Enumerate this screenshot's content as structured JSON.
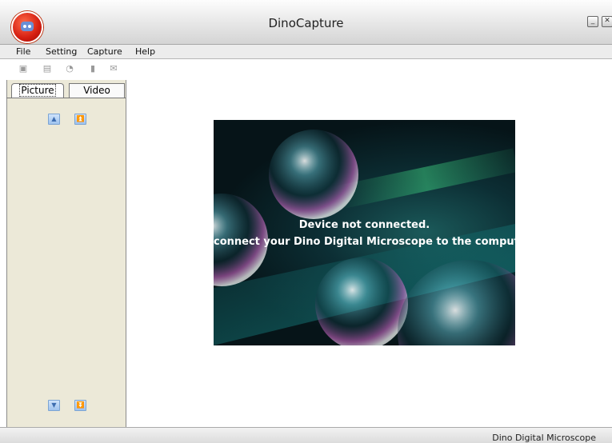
{
  "window": {
    "title": "DinoCapture",
    "minimize_glyph": "_",
    "close_glyph": "✕"
  },
  "menu": {
    "items": [
      {
        "label": "File"
      },
      {
        "label": "Setting"
      },
      {
        "label": "Capture"
      },
      {
        "label": "Help"
      }
    ]
  },
  "toolbar": {
    "icons": [
      "camera-icon",
      "film-icon",
      "clock-icon",
      "save-icon",
      "email-icon"
    ]
  },
  "left_panel": {
    "tabs": [
      {
        "label": "Picture",
        "active": true
      },
      {
        "label": "Video",
        "active": false
      }
    ],
    "scroll_up_glyph": "▲",
    "scroll_top_glyph": "⏫",
    "scroll_down_glyph": "▼",
    "scroll_bottom_glyph": "⏬"
  },
  "preview": {
    "line1": "Device not connected.",
    "line2": "connect your Dino Digital Microscope to the compute"
  },
  "status": {
    "text": "Dino Digital Microscope"
  },
  "colors": {
    "logo": "#d41d10",
    "panel": "#ece9d8",
    "arrow_button": "#9fc3ee"
  }
}
